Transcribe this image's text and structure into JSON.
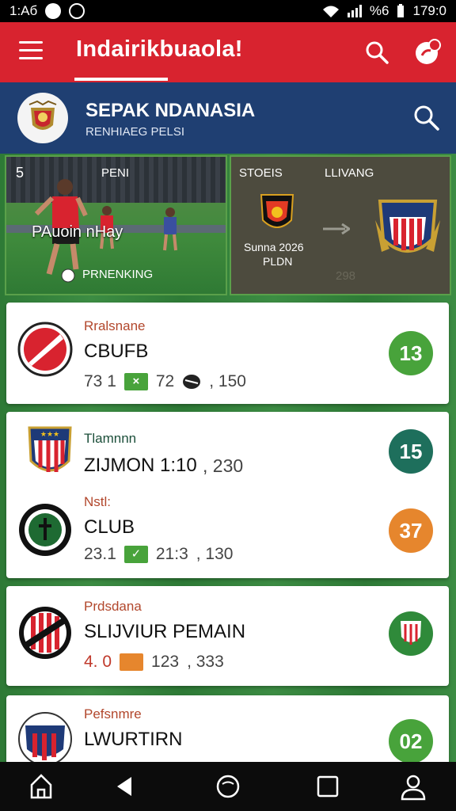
{
  "status_bar": {
    "time_left": "1:Aб",
    "battery_text": "%6",
    "time_right": "179:0"
  },
  "app_bar": {
    "title": "Indairikbuaola!",
    "icons": [
      "menu-icon",
      "search-icon",
      "notification-icon"
    ]
  },
  "league": {
    "title": "SEPAK NDANASIA",
    "subtitle": "RENHIAEG PELSI",
    "icons": [
      "league-crest-icon",
      "search-icon"
    ]
  },
  "hero": {
    "left": {
      "top_label": "PENI",
      "overlay_text": "PAuoin nHay",
      "bottom_label": "PRNENKING",
      "number": "5"
    },
    "right": {
      "label_left": "STOEIS",
      "label_right": "LLIVANG",
      "match_text": "Sunna 2026",
      "match_sub": "PLDN",
      "faded_number": "298"
    }
  },
  "cards": [
    {
      "kicker": "Rralsnane",
      "team": "CBUFB",
      "stat1": "73 1",
      "chip": "×",
      "stat2": "72",
      "stat3": ", 150",
      "score": "13",
      "score_color": "#48a33b",
      "kicker_color": "#b2472c",
      "crest": "red-white-crest"
    },
    {
      "kicker": "Tlamnnn",
      "team": "ZIJMON  1:10",
      "stat3": ", 230",
      "score": "15",
      "score_color": "#1e6f5c",
      "kicker_color": "#1c4f3a",
      "crest": "red-white-stripes-crest"
    },
    {
      "kicker": "Nstl:",
      "team": "CLUB",
      "stat1": "23.1",
      "chip": "✓",
      "stat2": "21:3",
      "stat3": ", 130",
      "score": "37",
      "score_color": "#e6862d",
      "kicker_color": "#b2472c",
      "crest": "green-black-crest"
    },
    {
      "kicker": "Prdsdana",
      "team": "SLIJVIUR PEMAIN",
      "stat1": "4. 0",
      "stat2": "123",
      "stat3": ", 333",
      "score_color": "#2f8a3a",
      "kicker_color": "#b2472c",
      "crest": "black-red-crest"
    },
    {
      "kicker": "Pefsnmre",
      "team": "LWURTIRN",
      "score": "02",
      "score_color": "#48a33b",
      "kicker_color": "#b2472c",
      "crest": "blue-red-crest"
    }
  ],
  "nav": {
    "icons": [
      "home-icon",
      "back-icon",
      "circle-icon",
      "square-icon",
      "profile-icon"
    ]
  }
}
